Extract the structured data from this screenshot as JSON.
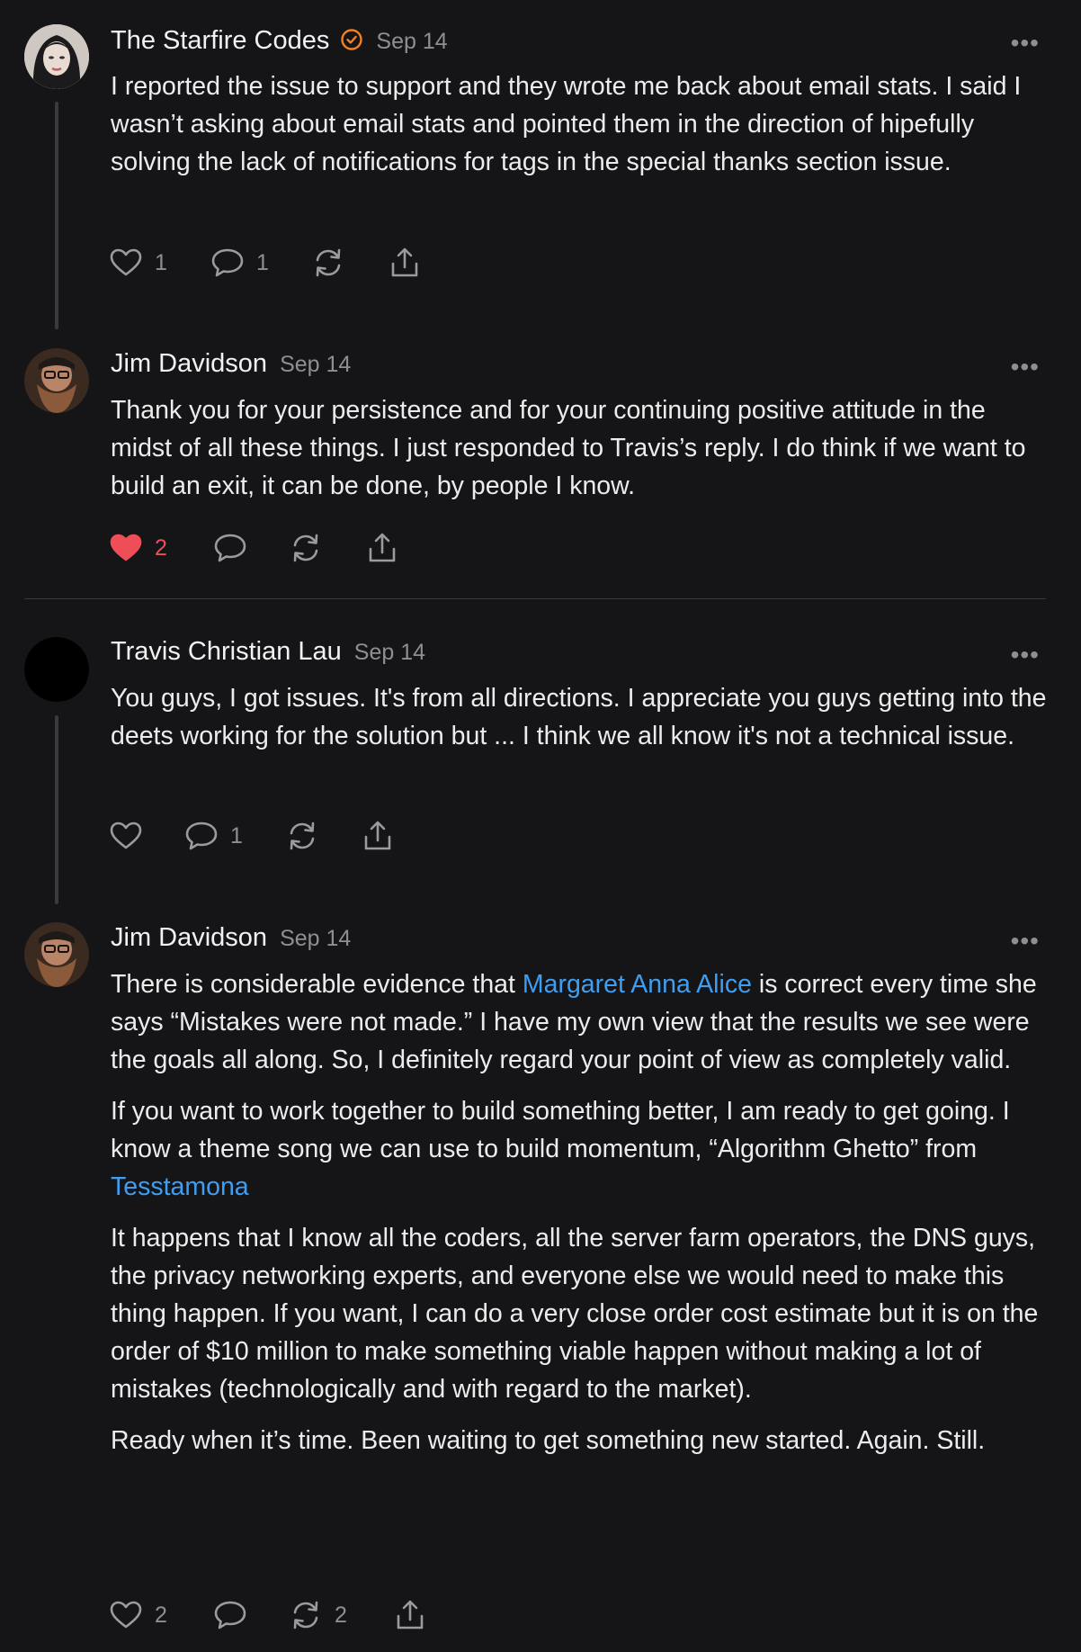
{
  "colors": {
    "background": "#151518",
    "text": "#ececec",
    "muted": "#8e8e93",
    "link": "#3d9ef2",
    "like": "#ef4e58",
    "verified": "#f5821f"
  },
  "comments": [
    {
      "author": "The Starfire Codes",
      "verified": true,
      "date": "Sep 14",
      "paragraphs": [
        "I reported the issue to support and they wrote me back about email stats. I said I wasn’t asking about email stats and pointed them in the direction of hipefully solving the lack of notifications for tags in the special thanks section issue."
      ],
      "likes": "1",
      "replies": "1",
      "liked": false
    },
    {
      "author": "Jim Davidson",
      "date": "Sep 14",
      "paragraphs": [
        "Thank you for your persistence and for your continuing positive attitude in the midst of all these things. I just responded to Travis’s reply. I do think if we want to build an exit, it can be done, by people I know."
      ],
      "likes": "2",
      "liked": true
    },
    {
      "author": "Travis Christian Lau",
      "date": "Sep 14",
      "paragraphs": [
        "You guys, I got issues. It's from all directions. I appreciate you guys getting into the deets working for the solution but ... I think we all know it's not a technical issue."
      ],
      "replies": "1",
      "liked": false
    },
    {
      "author": "Jim Davidson",
      "date": "Sep 14",
      "p1_before": "There is considerable evidence that ",
      "p1_link": "Margaret Anna Alice",
      "p1_after": " is correct every time she says “Mistakes were not made.” I have my own view that the results we see were the goals all along. So, I definitely regard your point of view as completely valid.",
      "p2_before": "If you want to work together to build something better, I am ready to get going. I know a theme song we can use to build momentum, “Algorithm Ghetto” from ",
      "p2_link": "Tesstamona",
      "p3": "It happens that I know all the coders, all the server farm operators, the DNS guys, the privacy networking experts, and everyone else we would need to make this thing happen. If you want, I can do a very close order cost estimate but it is on the order of $10 million to make something viable happen without making a lot of mistakes (technologically and with regard to the market).",
      "p4": "Ready when it’s time. Been waiting to get something new started. Again. Still.",
      "likes": "2",
      "restacks": "2",
      "liked": false
    }
  ],
  "more_label": "•••"
}
